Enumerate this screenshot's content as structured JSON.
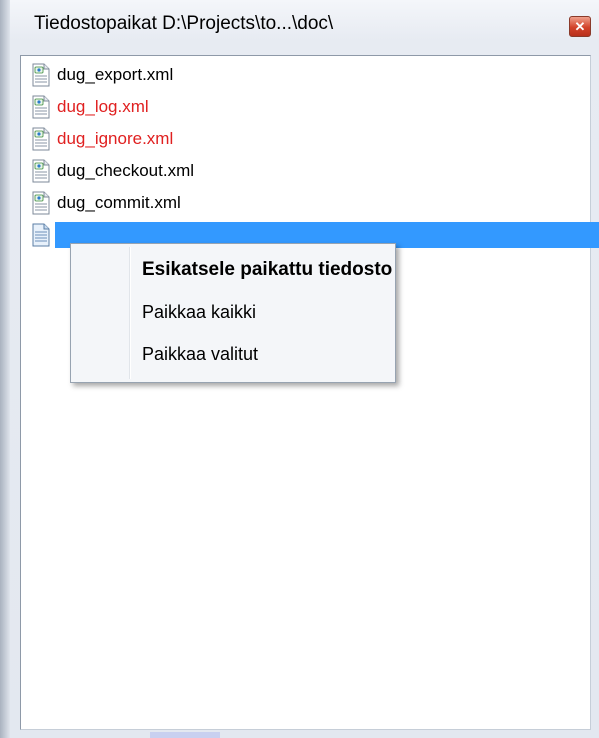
{
  "window": {
    "title": "Tiedostopaikat  D:\\Projects\\to...\\doc\\",
    "close_symbol": "✕"
  },
  "files": [
    {
      "name": "dug_export.xml",
      "color": "#000000",
      "icon": "xml-file-icon"
    },
    {
      "name": "dug_log.xml",
      "color": "#e02020",
      "icon": "xml-file-icon"
    },
    {
      "name": "dug_ignore.xml",
      "color": "#e02020",
      "icon": "xml-file-icon"
    },
    {
      "name": "dug_checkout.xml",
      "color": "#000000",
      "icon": "xml-file-icon"
    },
    {
      "name": "dug_commit.xml",
      "color": "#000000",
      "icon": "xml-file-icon"
    },
    {
      "name": "",
      "color": "#ffffff",
      "icon": "text-file-icon",
      "selected": true
    }
  ],
  "context_menu": {
    "items": [
      {
        "label": "Esikatsele paikattu tiedosto",
        "default": true
      },
      {
        "label": "Paikkaa kaikki",
        "default": false
      },
      {
        "label": "Paikkaa valitut",
        "default": false
      }
    ]
  },
  "colors": {
    "selection": "#3399ff",
    "conflict_text": "#e02020"
  }
}
